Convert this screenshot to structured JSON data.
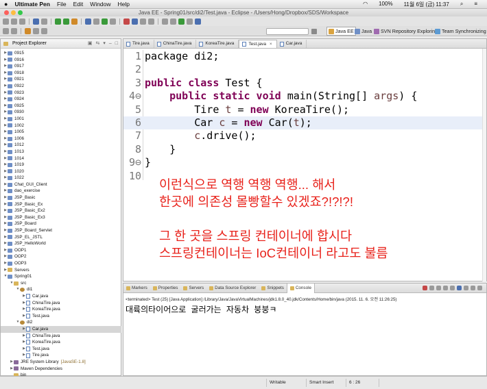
{
  "menubar": {
    "apple": "",
    "app_name": "Ultimate Pen",
    "items": [
      "File",
      "Edit",
      "Window",
      "Help"
    ],
    "battery": "100%",
    "clock": "11월 6일 (금)  11:37"
  },
  "window": {
    "title": "Java EE - Spring01/src/di2/Test.java - Eclipse - /Users/Hong/Dropbox/SDS/Workspace"
  },
  "perspectives": {
    "java_ee": "Java EE",
    "java": "Java",
    "svn": "SVN Repository Exploring",
    "team": "Team Synchronizing"
  },
  "explorer": {
    "title": "Project Explorer",
    "tree": [
      {
        "label": "0915",
        "depth": 0,
        "type": "proj",
        "arrow": "▶"
      },
      {
        "label": "0916",
        "depth": 0,
        "type": "proj",
        "arrow": "▶"
      },
      {
        "label": "0917",
        "depth": 0,
        "type": "proj",
        "arrow": "▶"
      },
      {
        "label": "0918",
        "depth": 0,
        "type": "proj",
        "arrow": "▶"
      },
      {
        "label": "0921",
        "depth": 0,
        "type": "proj",
        "arrow": "▶"
      },
      {
        "label": "0922",
        "depth": 0,
        "type": "proj",
        "arrow": "▶"
      },
      {
        "label": "0923",
        "depth": 0,
        "type": "proj",
        "arrow": "▶"
      },
      {
        "label": "0924",
        "depth": 0,
        "type": "proj",
        "arrow": "▶"
      },
      {
        "label": "0925",
        "depth": 0,
        "type": "proj",
        "arrow": "▶"
      },
      {
        "label": "0930",
        "depth": 0,
        "type": "proj",
        "arrow": "▶"
      },
      {
        "label": "1001",
        "depth": 0,
        "type": "proj",
        "arrow": "▶"
      },
      {
        "label": "1002",
        "depth": 0,
        "type": "proj",
        "arrow": "▶"
      },
      {
        "label": "1005",
        "depth": 0,
        "type": "proj",
        "arrow": "▶"
      },
      {
        "label": "1006",
        "depth": 0,
        "type": "proj",
        "arrow": "▶"
      },
      {
        "label": "1012",
        "depth": 0,
        "type": "proj",
        "arrow": "▶"
      },
      {
        "label": "1013",
        "depth": 0,
        "type": "proj",
        "arrow": "▶"
      },
      {
        "label": "1014",
        "depth": 0,
        "type": "proj",
        "arrow": "▶"
      },
      {
        "label": "1019",
        "depth": 0,
        "type": "proj",
        "arrow": "▶"
      },
      {
        "label": "1020",
        "depth": 0,
        "type": "proj",
        "arrow": "▶"
      },
      {
        "label": "1022",
        "depth": 0,
        "type": "proj",
        "arrow": "▶"
      },
      {
        "label": "Chat_GUI_Client",
        "depth": 0,
        "type": "proj",
        "arrow": "▶"
      },
      {
        "label": "dao_exercise",
        "depth": 0,
        "type": "proj",
        "arrow": "▶"
      },
      {
        "label": "JSP_Basic",
        "depth": 0,
        "type": "proj",
        "arrow": "▶"
      },
      {
        "label": "JSP_Basic_Ex",
        "depth": 0,
        "type": "proj",
        "arrow": "▶"
      },
      {
        "label": "JSP_Basic_Ex2",
        "depth": 0,
        "type": "proj",
        "arrow": "▶"
      },
      {
        "label": "JSP_Basic_Ex3",
        "depth": 0,
        "type": "proj",
        "arrow": "▶"
      },
      {
        "label": "JSP_Board",
        "depth": 0,
        "type": "proj",
        "arrow": "▶"
      },
      {
        "label": "JSP_Board_Servlet",
        "depth": 0,
        "type": "proj",
        "arrow": "▶"
      },
      {
        "label": "JSP_EL_JSTL",
        "depth": 0,
        "type": "proj",
        "arrow": "▶"
      },
      {
        "label": "JSP_HelloWorld",
        "depth": 0,
        "type": "proj",
        "arrow": "▶"
      },
      {
        "label": "OOP1",
        "depth": 0,
        "type": "proj",
        "arrow": "▶"
      },
      {
        "label": "OOP2",
        "depth": 0,
        "type": "proj",
        "arrow": "▶"
      },
      {
        "label": "OOP3",
        "depth": 0,
        "type": "proj",
        "arrow": "▶"
      },
      {
        "label": "Servers",
        "depth": 0,
        "type": "fold",
        "arrow": "▶"
      },
      {
        "label": "Spring01",
        "depth": 0,
        "type": "proj",
        "arrow": "▼"
      },
      {
        "label": "src",
        "depth": 1,
        "type": "fold",
        "arrow": "▼"
      },
      {
        "label": "di1",
        "depth": 2,
        "type": "pkg",
        "arrow": "▼"
      },
      {
        "label": "Car.java",
        "depth": 3,
        "type": "java",
        "arrow": "▶"
      },
      {
        "label": "ChinaTire.java",
        "depth": 3,
        "type": "java",
        "arrow": "▶"
      },
      {
        "label": "KoreaTire.java",
        "depth": 3,
        "type": "java",
        "arrow": "▶"
      },
      {
        "label": "Test.java",
        "depth": 3,
        "type": "java",
        "arrow": "▶"
      },
      {
        "label": "di2",
        "depth": 2,
        "type": "pkg",
        "arrow": "▼"
      },
      {
        "label": "Car.java",
        "depth": 3,
        "type": "java",
        "arrow": "▶",
        "selected": true
      },
      {
        "label": "ChinaTire.java",
        "depth": 3,
        "type": "java",
        "arrow": "▶"
      },
      {
        "label": "KoreaTire.java",
        "depth": 3,
        "type": "java",
        "arrow": "▶"
      },
      {
        "label": "Test.java",
        "depth": 3,
        "type": "java",
        "arrow": "▶"
      },
      {
        "label": "Tire.java",
        "depth": 3,
        "type": "java",
        "arrow": "▶"
      },
      {
        "label": "JRE System Library",
        "suffix": "[JavaSE-1.8]",
        "depth": 1,
        "type": "lib",
        "arrow": "▶"
      },
      {
        "label": "Maven Dependencies",
        "depth": 1,
        "type": "lib",
        "arrow": "▶"
      },
      {
        "label": "bin",
        "depth": 1,
        "type": "fold",
        "arrow": ""
      }
    ]
  },
  "editor": {
    "tabs": [
      {
        "label": "Tire.java",
        "active": false
      },
      {
        "label": "ChinaTire.java",
        "active": false
      },
      {
        "label": "KoreaTire.java",
        "active": false
      },
      {
        "label": "Test.java",
        "active": true
      },
      {
        "label": "Car.java",
        "active": false
      }
    ],
    "lines": [
      {
        "n": "1",
        "html": "<span class=\"kw\"></span>package di2;"
      },
      {
        "n": "2",
        "html": ""
      },
      {
        "n": "3",
        "html": "<span class=\"kw\">public class</span> Test {"
      },
      {
        "n": "4⊖",
        "html": "    <span class=\"kw\">public static void</span> main(String[] <span class=\"var\">args</span>) {"
      },
      {
        "n": "5",
        "html": "        Tire <span class=\"var\">t</span> = <span class=\"kw\">new</span> KoreaTire();"
      },
      {
        "n": "6",
        "html": "        Car <span class=\"var\">c</span> = <span class=\"kw\">new</span> Car(<span class=\"var\">t</span>);",
        "current": true
      },
      {
        "n": "7",
        "html": "        <span class=\"var\">c</span>.drive();"
      },
      {
        "n": "8",
        "html": "    }"
      },
      {
        "n": "9⊖",
        "html": "}"
      },
      {
        "n": "10",
        "html": ""
      }
    ],
    "annotation": [
      "이런식으로 역행 역행 역행... 해서",
      "한곳에 의존성 몰빵할수 있겠죠?!?!?!",
      "",
      "그 한 곳을 스프링 컨테이너에 합시다",
      "스프링컨테이너는 IoC컨테이너 라고도 불름"
    ],
    "annotation_color": "#e8221b"
  },
  "console": {
    "tabs": [
      "Markers",
      "Properties",
      "Servers",
      "Data Source Explorer",
      "Snippets",
      "Console"
    ],
    "active_tab": "Console",
    "terminated": "<terminated> Test (25) [Java Application] /Library/Java/JavaVirtualMachines/jdk1.8.0_40.jdk/Contents/Home/bin/java (2015. 11. 6. 오전 11:26:25)",
    "output": "대륙의타이어으로 굴러가는 자동차 붕붕ㅋ"
  },
  "statusbar": {
    "writable": "Writable",
    "insert_mode": "Smart Insert",
    "position": "6 : 26"
  }
}
